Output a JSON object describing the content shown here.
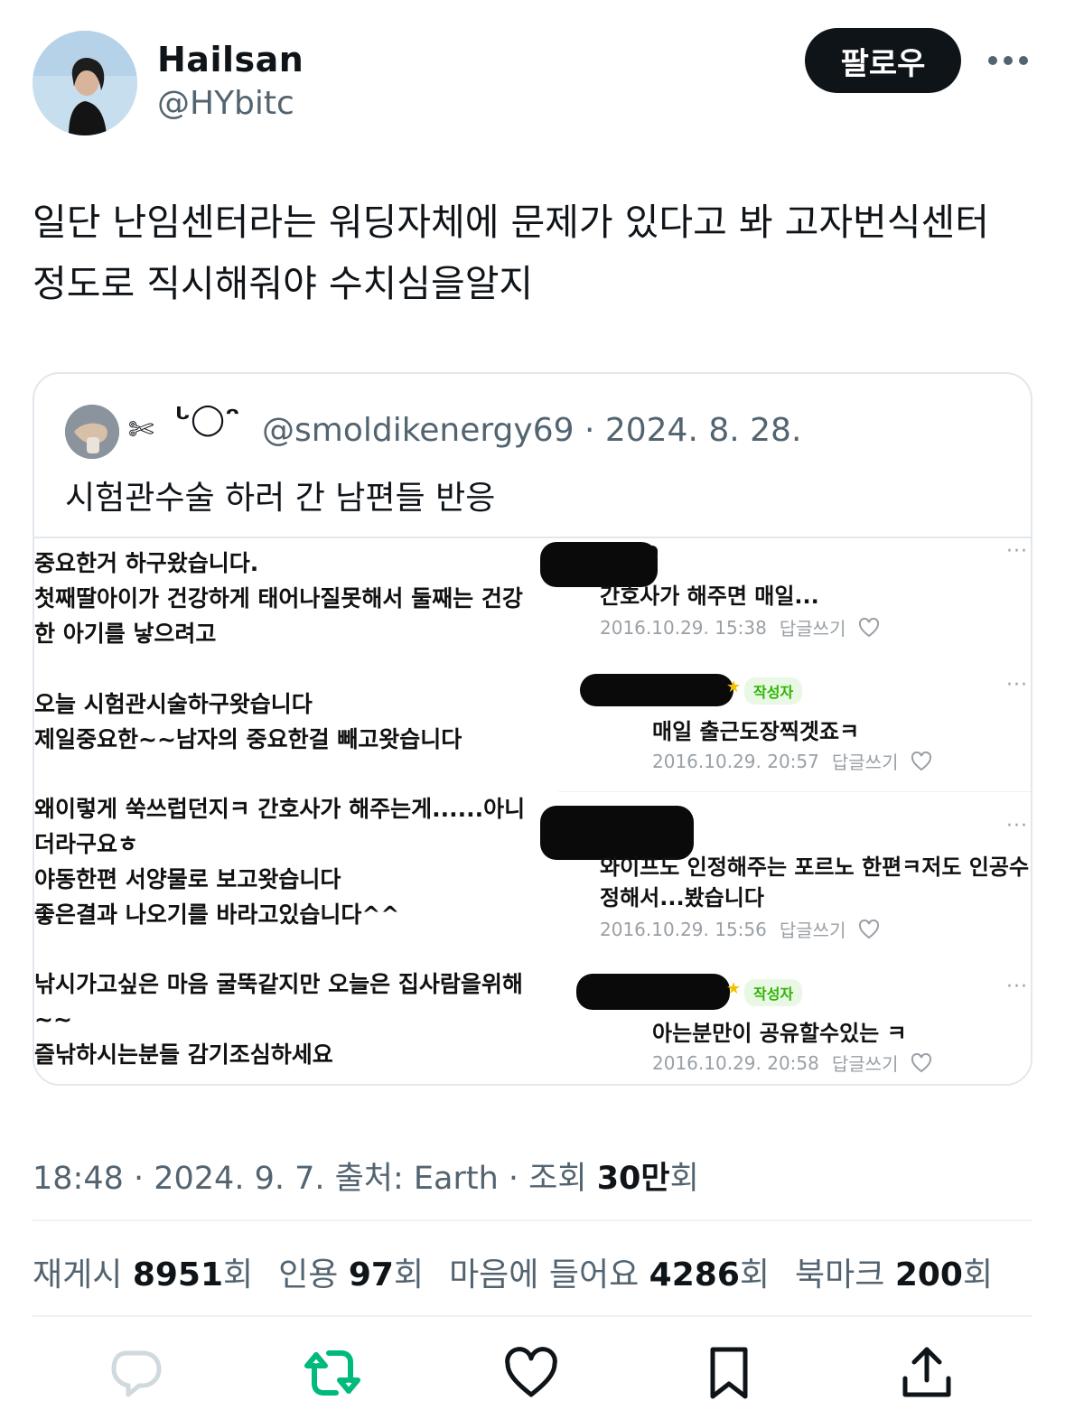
{
  "author": {
    "name": "Hailsan",
    "handle": "@HYbitc",
    "follow_label": "팔로우"
  },
  "tweet": {
    "text_line1": "일단 난임센터라는 워딩자체에 문제가 있다고 봐 고자번식센터",
    "text_line2": "정도로 직시해줘야 수치심을알지"
  },
  "quote": {
    "name_scissors": "✄",
    "name_face": "ᒡ◯ᵔ",
    "handle_date": "@smoldikenergy69 · 2024. 8. 28.",
    "text": "시험관수술 하러 간 남편들 반응",
    "image": {
      "left_blocks": [
        [
          "중요한거 하구왔습니다.",
          "첫째딸아이가 건강하게 태어나질못해서 둘째는 건강",
          "한 아기를 낳으려고"
        ],
        [
          "오늘 시험관시술하구왓습니다",
          "제일중요한~~남자의 중요한걸 빼고왓습니다"
        ],
        [
          "왜이렇게 쑥쓰럽던지ㅋ 간호사가 해주는게......아니",
          "더라구요ㅎ",
          "야동한편 서양물로 보고왓습니다",
          "좋은결과 나오기를 바라고있습니다^^"
        ],
        [
          "낚시가고싶은 마음 굴뚝같지만 오늘은 집사람을위해",
          "~~",
          "즐낚하시는분들 감기조심하세요"
        ]
      ],
      "comments": [
        {
          "text": "간호사가 해주면 매일...",
          "time": "2016.10.29. 15:38",
          "reply": "답글쓰기",
          "badge": ""
        },
        {
          "text": "매일 출근도장찍겟죠ㅋ",
          "time": "2016.10.29. 20:57",
          "reply": "답글쓰기",
          "badge": "작성자"
        },
        {
          "text": "와이프도 인정해주는 포르노 한편ㅋ저도 인공수",
          "text2": "정해서...봤습니다",
          "time": "2016.10.29. 15:56",
          "reply": "답글쓰기",
          "badge": ""
        },
        {
          "text": "아는분만이 공유할수있는 ㅋ",
          "time": "2016.10.29. 20:58",
          "reply": "답글쓰기",
          "badge": "작성자"
        }
      ],
      "dots": "···"
    }
  },
  "timestamp": {
    "time_date": "18:48 · 2024. 9. 7. 출처: Earth · 조회 ",
    "views": "30만",
    "views_suffix": "회"
  },
  "stats": {
    "retweets_label": "재게시 ",
    "retweets": "8951",
    "quotes_label": "인용 ",
    "quotes": "97",
    "likes_label": "마음에 들어요 ",
    "likes": "4286",
    "bookmarks_label": "북마크 ",
    "bookmarks": "200",
    "unit": "회"
  },
  "colors": {
    "secondary_text": "#536471",
    "retweet_green": "#00ba7c",
    "reply_light": "#cfd9de",
    "badge_green": "#2db400"
  },
  "icons": [
    "reply-icon",
    "retweet-icon",
    "like-icon",
    "bookmark-icon",
    "share-icon",
    "more-icon"
  ]
}
